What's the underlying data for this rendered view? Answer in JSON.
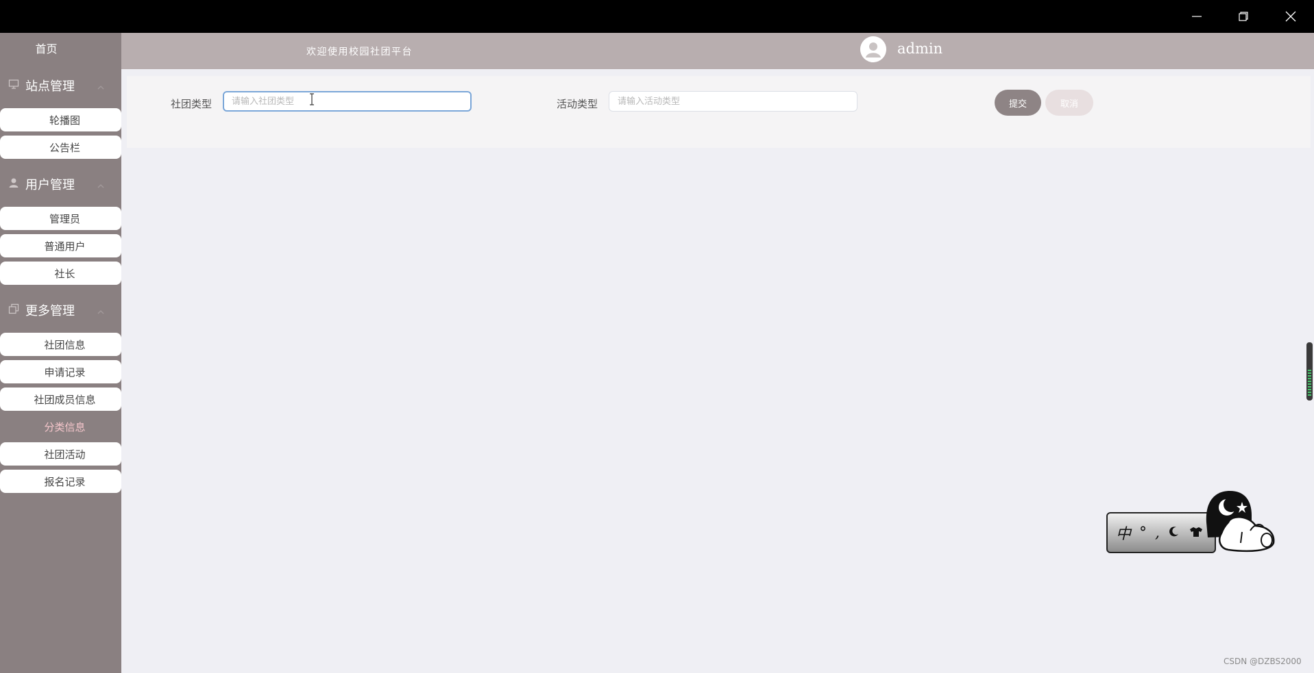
{
  "window": {
    "controls": [
      "minimize",
      "restore",
      "close"
    ]
  },
  "sidebar": {
    "home": "首页",
    "groups": [
      {
        "label": "站点管理",
        "icon": "monitor-icon",
        "items": [
          {
            "label": "轮播图"
          },
          {
            "label": "公告栏"
          }
        ]
      },
      {
        "label": "用户管理",
        "icon": "user-icon",
        "items": [
          {
            "label": "管理员"
          },
          {
            "label": "普通用户"
          },
          {
            "label": "社长"
          }
        ]
      },
      {
        "label": "更多管理",
        "icon": "copy-icon",
        "items": [
          {
            "label": "社团信息"
          },
          {
            "label": "申请记录"
          },
          {
            "label": "社团成员信息"
          },
          {
            "label": "分类信息",
            "active": true
          },
          {
            "label": "社团活动"
          },
          {
            "label": "报名记录"
          }
        ]
      }
    ]
  },
  "header": {
    "welcome": "欢迎使用校园社团平台",
    "username": "admin"
  },
  "form": {
    "club_type_label": "社团类型",
    "club_type_placeholder": "请输入社团类型",
    "club_type_value": "",
    "activity_type_label": "活动类型",
    "activity_type_placeholder": "请输入活动类型",
    "activity_type_value": "",
    "submit_label": "提交",
    "cancel_label": "取消"
  },
  "ime": {
    "mode": "中",
    "chars": [
      "°",
      ","
    ]
  },
  "watermark": "CSDN @DZBS2000",
  "colors": {
    "sidebar_bg": "#8a8081",
    "header_bg": "#b8aeaf",
    "active_text": "#f6c6cc",
    "submit_bg": "#8e8485",
    "cancel_bg": "#e8dfe0",
    "page_bg": "#efeff4"
  }
}
